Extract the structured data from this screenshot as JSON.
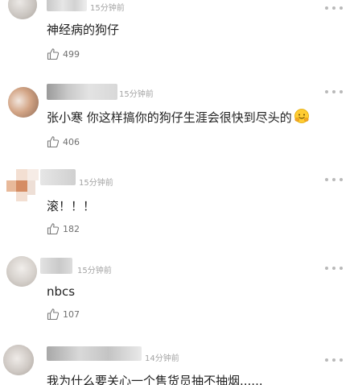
{
  "comments": [
    {
      "time": "15分钟前",
      "text": "神经病的狗仔",
      "likes": "499",
      "icon": "thumbs-up-icon"
    },
    {
      "time": "15分钟前",
      "text": "张小寒 你这样搞你的狗仔生涯会很快到尽头的",
      "emoji": "hugging-face-emoji",
      "likes": "406",
      "icon": "thumbs-up-icon"
    },
    {
      "time": "15分钟前",
      "text": "滚！！！",
      "likes": "182",
      "icon": "thumbs-up-icon"
    },
    {
      "time": "15分钟前",
      "text": "nbcs",
      "likes": "107",
      "icon": "thumbs-up-icon"
    },
    {
      "time": "14分钟前",
      "text": "我为什么要关心一个售货员抽不抽烟......",
      "icon": "thumbs-up-icon"
    }
  ],
  "more_icon": "more-dots-icon",
  "colors": {
    "text": "#222222",
    "meta": "#a3a3a3",
    "like": "#6f6f6f"
  }
}
